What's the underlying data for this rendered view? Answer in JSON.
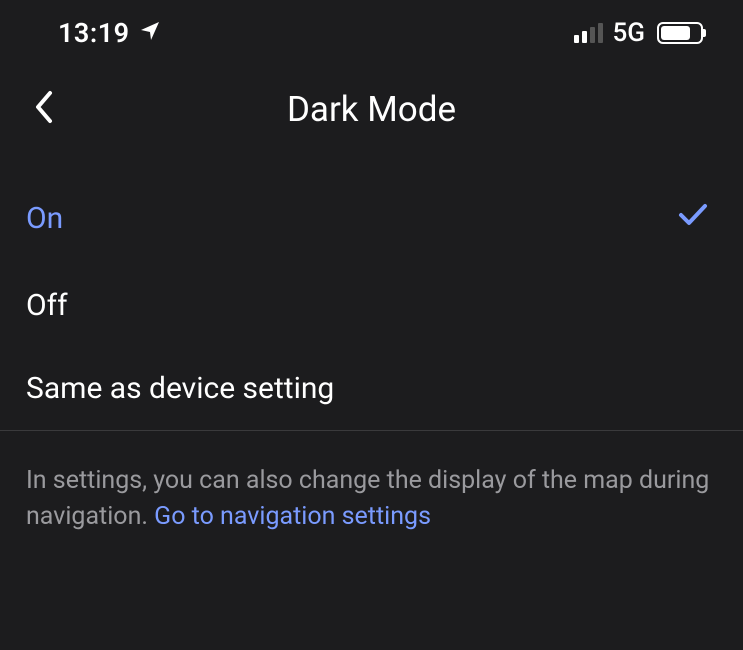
{
  "statusBar": {
    "time": "13:19",
    "network": "5G"
  },
  "header": {
    "title": "Dark Mode"
  },
  "options": [
    {
      "label": "On",
      "selected": true
    },
    {
      "label": "Off",
      "selected": false
    },
    {
      "label": "Same as device setting",
      "selected": false
    }
  ],
  "footer": {
    "text": "In settings, you can also change the display of the map during navigation. ",
    "linkText": "Go to navigation settings"
  },
  "colors": {
    "accent": "#7a9bff"
  }
}
